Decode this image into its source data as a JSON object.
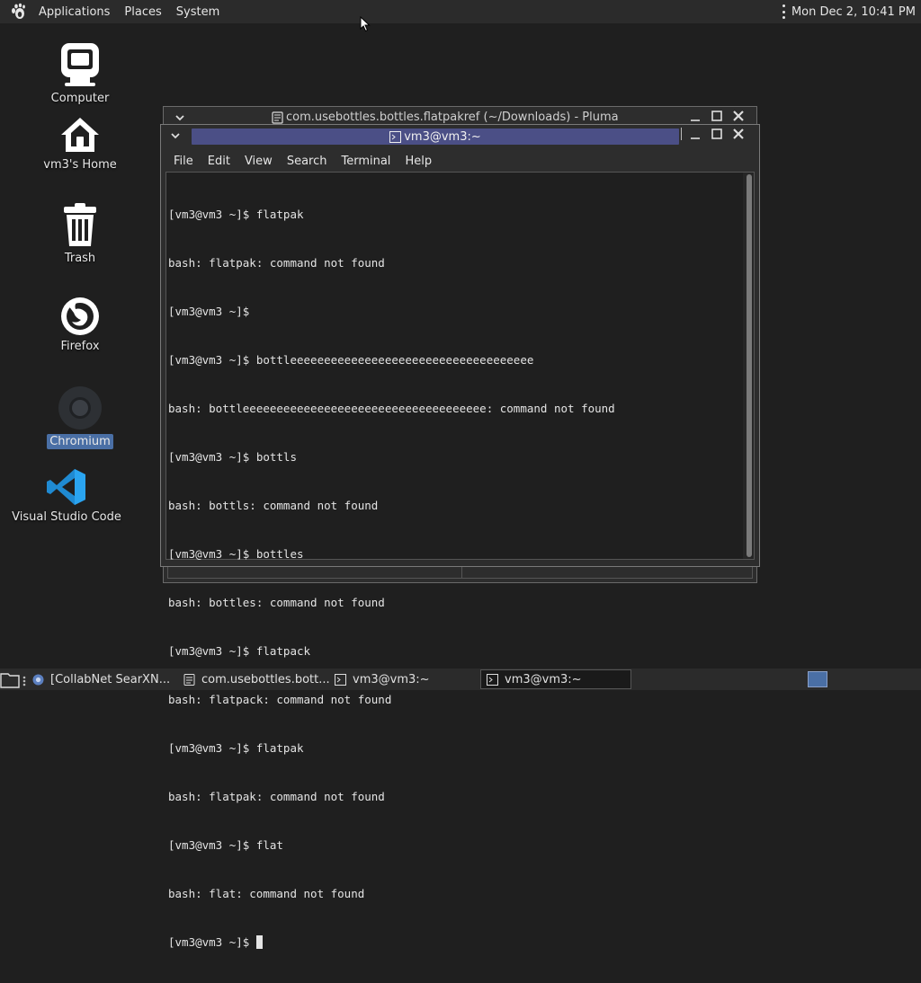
{
  "top_panel": {
    "menus": [
      "Applications",
      "Places",
      "System"
    ],
    "clock": "Mon Dec  2, 10:41 PM"
  },
  "desktop_icons": [
    {
      "label": "Computer",
      "icon": "computer-icon"
    },
    {
      "label": "vm3's Home",
      "icon": "home-icon"
    },
    {
      "label": "Trash",
      "icon": "trash-icon"
    },
    {
      "label": "Firefox",
      "icon": "firefox-icon"
    },
    {
      "label": "Chromium",
      "icon": "chromium-icon",
      "selected": true
    },
    {
      "label": "Visual Studio Code",
      "icon": "vscode-icon"
    }
  ],
  "pluma_window": {
    "title": "com.usebottles.bottles.flatpakref (~/Downloads) - Pluma"
  },
  "terminal_window": {
    "title": "vm3@vm3:~",
    "menu": [
      "File",
      "Edit",
      "View",
      "Search",
      "Terminal",
      "Help"
    ],
    "lines": [
      "[vm3@vm3 ~]$ flatpak",
      "bash: flatpak: command not found",
      "[vm3@vm3 ~]$ ",
      "[vm3@vm3 ~]$ bottleeeeeeeeeeeeeeeeeeeeeeeeeeeeeeeeeeee",
      "bash: bottleeeeeeeeeeeeeeeeeeeeeeeeeeeeeeeeeeee: command not found",
      "[vm3@vm3 ~]$ bottls",
      "bash: bottls: command not found",
      "[vm3@vm3 ~]$ bottles",
      "bash: bottles: command not found",
      "[vm3@vm3 ~]$ flatpack",
      "bash: flatpack: command not found",
      "[vm3@vm3 ~]$ flatpak",
      "bash: flatpak: command not found",
      "[vm3@vm3 ~]$ flat",
      "bash: flat: command not found"
    ],
    "prompt": "[vm3@vm3 ~]$ "
  },
  "taskbar": {
    "tasks": [
      {
        "label": "[CollabNet SearXN...",
        "icon": "chromium-icon"
      },
      {
        "label": "com.usebottles.bott...",
        "icon": "text-editor-icon"
      },
      {
        "label": "vm3@vm3:~",
        "icon": "terminal-icon"
      },
      {
        "label": "vm3@vm3:~",
        "icon": "terminal-icon",
        "active": true
      }
    ]
  }
}
